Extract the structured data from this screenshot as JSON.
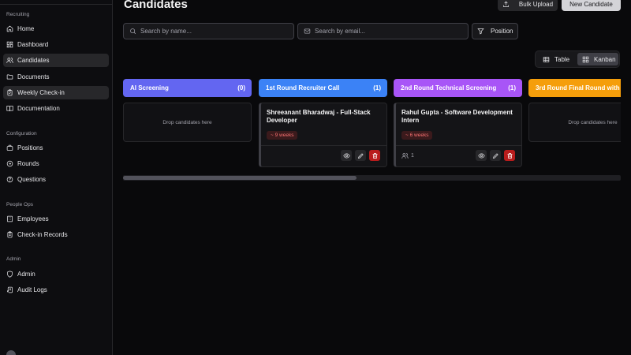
{
  "sidebar": {
    "sections": [
      {
        "label": "Recruiting",
        "items": [
          {
            "label": "Home",
            "icon": "home-icon",
            "active": false
          },
          {
            "label": "Dashboard",
            "icon": "dashboard-icon",
            "active": false
          },
          {
            "label": "Candidates",
            "icon": "users-icon",
            "active": true
          },
          {
            "label": "Documents",
            "icon": "folder-icon",
            "active": false
          },
          {
            "label": "Weekly Check-in",
            "icon": "clipboard-icon",
            "active": true
          },
          {
            "label": "Documentation",
            "icon": "book-icon",
            "active": false
          }
        ]
      },
      {
        "label": "Configuration",
        "items": [
          {
            "label": "Positions",
            "icon": "briefcase-icon",
            "active": false
          },
          {
            "label": "Rounds",
            "icon": "target-icon",
            "active": false
          },
          {
            "label": "Questions",
            "icon": "help-circle-icon",
            "active": false
          }
        ]
      },
      {
        "label": "People Ops",
        "items": [
          {
            "label": "Employees",
            "icon": "building-icon",
            "active": false
          },
          {
            "label": "Check-in Records",
            "icon": "clipboard-list-icon",
            "active": false
          }
        ]
      },
      {
        "label": "Admin",
        "items": [
          {
            "label": "Admin",
            "icon": "shield-icon",
            "active": false
          },
          {
            "label": "Audit Logs",
            "icon": "scroll-icon",
            "active": false
          }
        ]
      }
    ]
  },
  "header": {
    "title": "Candidates",
    "bulk_upload_label": "Bulk Upload",
    "new_candidate_label": "New Candidate"
  },
  "filters": {
    "search_name_placeholder": "Search by name...",
    "search_email_placeholder": "Search by email...",
    "position_label": "Position"
  },
  "view_toggle": {
    "table_label": "Table",
    "kanban_label": "Kanban",
    "selected": "Kanban"
  },
  "board": {
    "columns": [
      {
        "title": "AI Screening",
        "count": "(0)",
        "color": "#6366f1",
        "empty_text": "Drop candidates here",
        "cards": []
      },
      {
        "title": "1st Round Recruiter Call",
        "count": "(1)",
        "color": "#3b82f6",
        "empty_text": "",
        "cards": [
          {
            "title": "Shreeanant Bharadwaj - Full-Stack Developer",
            "badge": "~ 9 weeks",
            "count": ""
          }
        ]
      },
      {
        "title": "2nd Round Technical Screening",
        "count": "(1)",
        "color": "#a855f7",
        "empty_text": "",
        "cards": [
          {
            "title": "Rahul Gupta - Software Development Intern",
            "badge": "~ 6 weeks",
            "count": "1"
          }
        ]
      },
      {
        "title": "3rd Round Final Round with",
        "count": "",
        "color": "#f59e0b",
        "empty_text": "Drop candidates here",
        "cards": []
      }
    ]
  },
  "scrollbar": {
    "position_fraction": 0
  }
}
